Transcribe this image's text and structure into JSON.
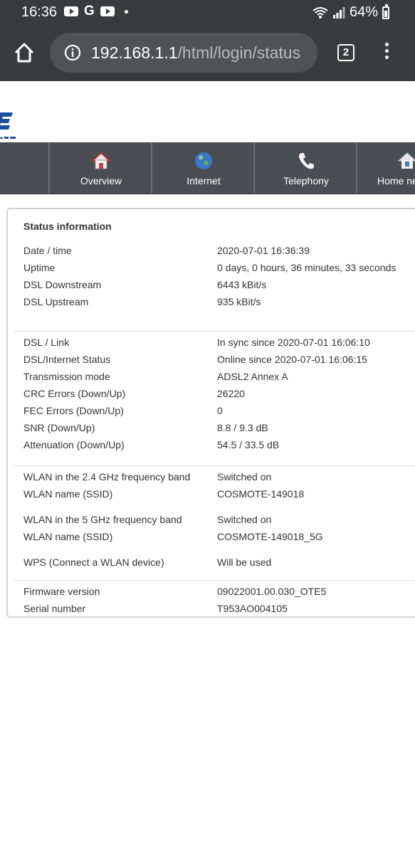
{
  "status_bar": {
    "time": "16:36",
    "battery": "64%"
  },
  "browser": {
    "url_host": "192.168.1.1",
    "url_path": "/html/login/status",
    "tab_count": "2"
  },
  "nav": {
    "items": [
      {
        "label": "Overview",
        "icon": "home-icon"
      },
      {
        "label": "Internet",
        "icon": "globe-icon"
      },
      {
        "label": "Telephony",
        "icon": "phone-icon"
      },
      {
        "label": "Home ne",
        "icon": "home-network-icon"
      }
    ]
  },
  "status": {
    "title": "Status information",
    "group1": [
      {
        "label": "Date / time",
        "value": "2020-07-01 16:36:39"
      },
      {
        "label": "Uptime",
        "value": "0 days, 0 hours, 36 minutes, 33 seconds"
      },
      {
        "label": "DSL Downstream",
        "value": "6443 kBit/s"
      },
      {
        "label": "DSL Upstream",
        "value": "935 kBit/s"
      }
    ],
    "group2": [
      {
        "label": "DSL / Link",
        "value": "In sync since 2020-07-01 16:06:10"
      },
      {
        "label": "DSL/Internet Status",
        "value": "Online since 2020-07-01 16:06:15"
      },
      {
        "label": "Transmission mode",
        "value": "ADSL2 Annex A"
      },
      {
        "label": "CRC Errors (Down/Up)",
        "value": "26220"
      },
      {
        "label": "FEC Errors (Down/Up)",
        "value": "0"
      },
      {
        "label": "SNR (Down/Up)",
        "value": "8.8 / 9.3 dB"
      },
      {
        "label": "Attenuation (Down/Up)",
        "value": "54.5 / 33.5 dB"
      }
    ],
    "group3": [
      {
        "label": "WLAN in the 2.4 GHz frequency band",
        "value": "Switched on"
      },
      {
        "label": "WLAN name (SSID)",
        "value": "COSMOTE-149018"
      },
      {
        "label": "WLAN in the 5 GHz frequency band",
        "value": "Switched on"
      },
      {
        "label": "WLAN name (SSID)",
        "value": "COSMOTE-149018_5G"
      },
      {
        "label": "WPS (Connect a WLAN device)",
        "value": "Will be used"
      }
    ],
    "group4": [
      {
        "label": "Firmware version",
        "value": "09022001.00.030_OTE5"
      },
      {
        "label": "Serial number",
        "value": "T953AO004105"
      }
    ]
  }
}
